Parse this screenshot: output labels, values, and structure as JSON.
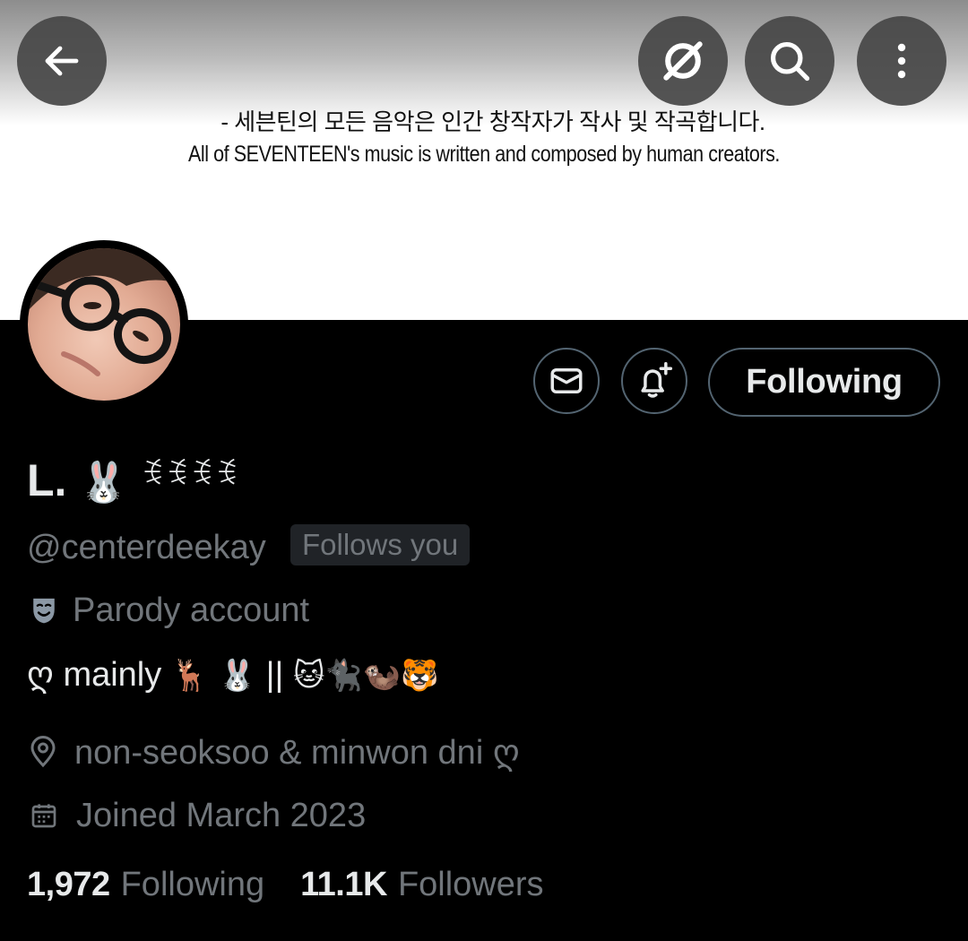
{
  "banner": {
    "line_ko": "- 세븐틴의 모든 음악은 인간 창작자가 작사 및 작곡합니다.",
    "line_en": "All of SEVENTEEN's music is written and composed by human creators."
  },
  "nav": {
    "back_icon": "arrow-left-icon",
    "grok_icon": "grok-icon",
    "search_icon": "search-icon",
    "more_icon": "more-vertical-icon"
  },
  "actions": {
    "message_icon": "envelope-icon",
    "notify_icon": "bell-plus-icon",
    "following_label": "Following"
  },
  "profile": {
    "name": "L.",
    "name_emoji": "🐰",
    "name_glyphs": "ꉂꉂꉂꉂ",
    "handle": "@centerdeekay",
    "follows_you": "Follows you",
    "parody_label": "Parody account",
    "bio_prefix": "ღ",
    "bio_text": "mainly",
    "bio_emoji_1": "🦌",
    "bio_emoji_2": "🐰",
    "bio_sep": "||",
    "bio_emoji_3": "🐱🐈‍⬛🦦🐯",
    "location": "non-seoksoo & minwon dni ღ",
    "joined": "Joined March 2023"
  },
  "stats": {
    "following_count": "1,972",
    "following_label": "Following",
    "followers_count": "11.1K",
    "followers_label": "Followers"
  },
  "colors": {
    "background": "#000000",
    "text_primary": "#e7e9ea",
    "text_secondary": "#71767b",
    "border": "#536471",
    "badge_bg": "#202327"
  }
}
